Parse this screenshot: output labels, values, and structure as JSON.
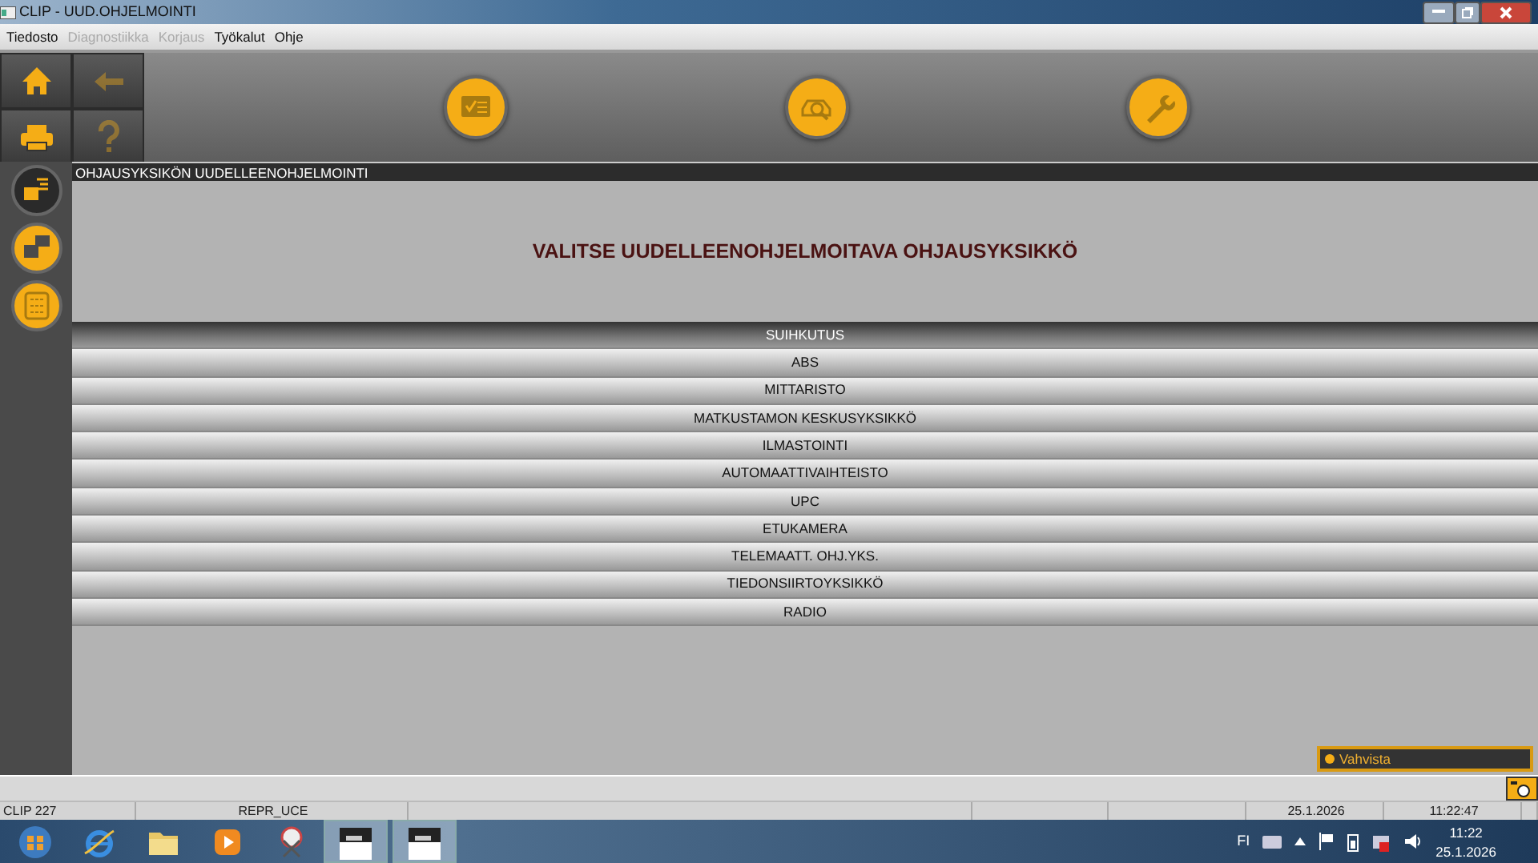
{
  "window": {
    "title": "CLIP - UUD.OHJELMOINTI"
  },
  "menu": [
    {
      "label": "Tiedosto",
      "disabled": false
    },
    {
      "label": "Diagnostiikka",
      "disabled": true
    },
    {
      "label": "Korjaus",
      "disabled": true
    },
    {
      "label": "Työkalut",
      "disabled": false
    },
    {
      "label": "Ohje",
      "disabled": false
    }
  ],
  "tool_buttons": [
    {
      "kind": "home",
      "disabled": false
    },
    {
      "kind": "back",
      "disabled": true
    },
    {
      "kind": "print",
      "disabled": false
    },
    {
      "kind": "help",
      "disabled": true
    }
  ],
  "mode_buttons": [
    {
      "kind": "checklist"
    },
    {
      "kind": "vehicle"
    },
    {
      "kind": "wrench"
    }
  ],
  "side_buttons": [
    {
      "kind": "ecu-code",
      "selected": true
    },
    {
      "kind": "ecu-swap",
      "selected": false
    },
    {
      "kind": "keypad",
      "selected": false
    }
  ],
  "section_title": "OHJAUSYKSIKÖN UUDELLEENOHJELMOINTI",
  "prompt": "VALITSE UUDELLEENOHJELMOITAVA OHJAUSYKSIKKÖ",
  "units": [
    {
      "label": "SUIHKUTUS",
      "selected": true
    },
    {
      "label": "ABS",
      "selected": false
    },
    {
      "label": "MITTARISTO",
      "selected": false
    },
    {
      "label": "MATKUSTAMON KESKUSYKSIKKÖ",
      "selected": false
    },
    {
      "label": "ILMASTOINTI",
      "selected": false
    },
    {
      "label": "AUTOMAATTIVAIHTEISTO",
      "selected": false
    },
    {
      "label": "UPC",
      "selected": false
    },
    {
      "label": "ETUKAMERA",
      "selected": false
    },
    {
      "label": "TELEMAATT. OHJ.YKS.",
      "selected": false
    },
    {
      "label": "TIEDONSIIRTOYKSIKKÖ",
      "selected": false
    },
    {
      "label": "RADIO",
      "selected": false
    }
  ],
  "confirm_button": "Vahvista",
  "status_bar": [
    "CLIP 227",
    "REPR_UCE",
    "25.1.2026",
    "11:22:47"
  ],
  "taskbar": {
    "apps": [
      {
        "kind": "start"
      },
      {
        "kind": "browser"
      },
      {
        "kind": "folder"
      },
      {
        "kind": "player"
      },
      {
        "kind": "snip"
      },
      {
        "kind": "clip"
      },
      {
        "kind": "clip"
      }
    ],
    "language": "FI",
    "time": "11:22",
    "date": "25.1.2026"
  }
}
